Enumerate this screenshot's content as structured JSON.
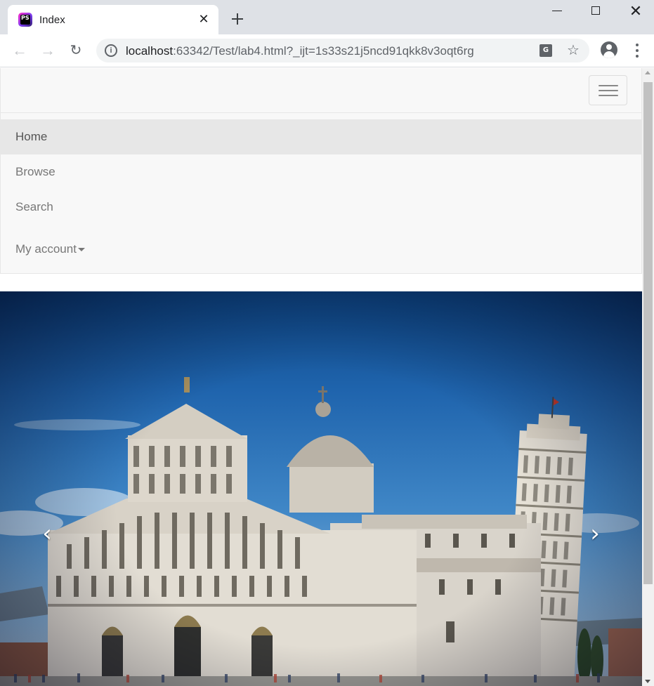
{
  "browser": {
    "tab_title": "Index",
    "favicon_text": "PS",
    "url_host": "localhost",
    "url_rest": ":63342/Test/lab4.html?_ijt=1s33s21j5ncd91qkk8v3oqt6rg",
    "tab_close_glyph": "✕",
    "window_close_glyph": "✕",
    "back_glyph": "←",
    "forward_glyph": "→",
    "reload_glyph": "↻",
    "star_glyph": "☆",
    "translate_glyph": "G"
  },
  "navbar": {
    "items": [
      {
        "label": "Home",
        "active": true
      },
      {
        "label": "Browse",
        "active": false
      },
      {
        "label": "Search",
        "active": false
      },
      {
        "label": "My account",
        "active": false,
        "dropdown": true
      }
    ]
  },
  "carousel": {
    "prev_glyph": "‹",
    "next_glyph": "›",
    "slide_subject": "Pisa Cathedral and Leaning Tower"
  }
}
